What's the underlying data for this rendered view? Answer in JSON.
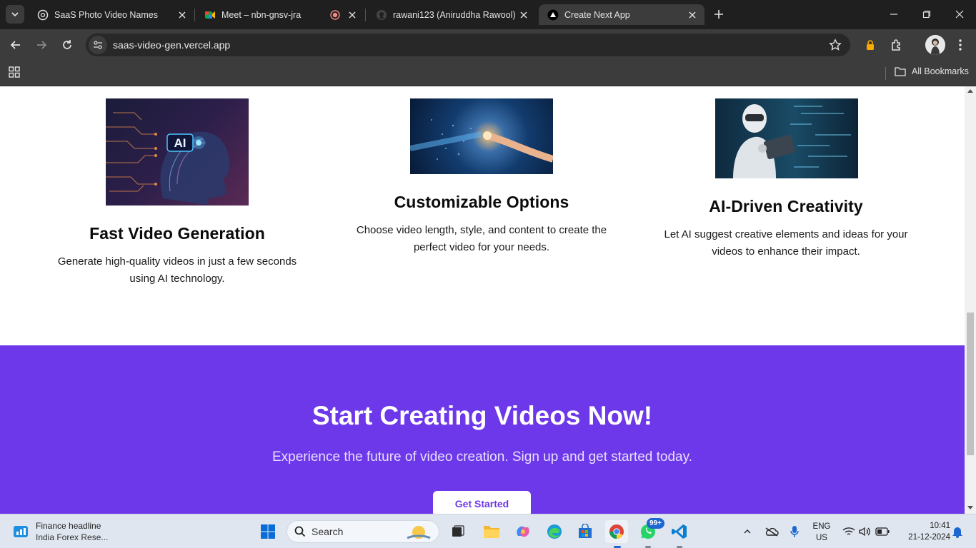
{
  "browser": {
    "tabs": [
      {
        "title": "SaaS Photo Video Names",
        "active": false
      },
      {
        "title": "Meet – nbn-gnsv-jra",
        "active": false
      },
      {
        "title": "rawani123 (Aniruddha Rawool)",
        "active": false
      },
      {
        "title": "Create Next App",
        "active": true
      }
    ],
    "url": "saas-video-gen.vercel.app",
    "bookmarks_label": "All Bookmarks"
  },
  "features": [
    {
      "title": "Fast Video Generation",
      "description": "Generate high-quality videos in just a few seconds using AI technology.",
      "image_label": "AI"
    },
    {
      "title": "Customizable Options",
      "description": "Choose video length, style, and content to create the perfect video for your needs."
    },
    {
      "title": "AI-Driven Creativity",
      "description": "Let AI suggest creative elements and ideas for your videos to enhance their impact."
    }
  ],
  "cta": {
    "title": "Start Creating Videos Now!",
    "subtitle": "Experience the future of video creation. Sign up and get started today.",
    "button": "Get Started",
    "background": "#6d38e9"
  },
  "taskbar": {
    "widget_title": "Finance headline",
    "widget_sub": "India Forex Rese...",
    "search_placeholder": "Search",
    "whatsapp_badge": "99+",
    "language": "ENG",
    "region": "US",
    "time": "10:41",
    "date": "21-12-2024"
  }
}
